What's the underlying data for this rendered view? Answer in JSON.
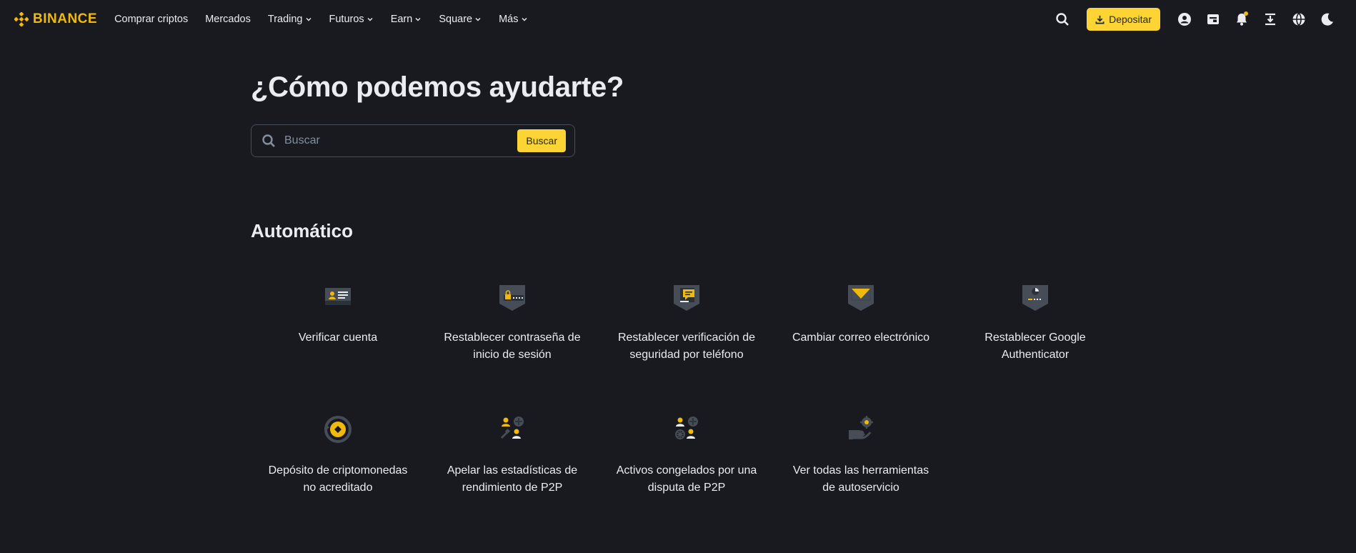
{
  "brand": {
    "name": "BINANCE",
    "color": "#f0b90b"
  },
  "nav": {
    "items": [
      {
        "label": "Comprar criptos",
        "dropdown": false
      },
      {
        "label": "Mercados",
        "dropdown": false
      },
      {
        "label": "Trading",
        "dropdown": true
      },
      {
        "label": "Futuros",
        "dropdown": true
      },
      {
        "label": "Earn",
        "dropdown": true
      },
      {
        "label": "Square",
        "dropdown": true
      },
      {
        "label": "Más",
        "dropdown": true
      }
    ],
    "deposit_label": "Depositar",
    "right_icons": [
      "search-icon",
      "user-icon",
      "wallet-icon",
      "bell-icon",
      "download-icon",
      "globe-icon",
      "moon-icon"
    ]
  },
  "hero": {
    "title": "¿Cómo podemos ayudarte?",
    "search_placeholder": "Buscar",
    "search_button": "Buscar"
  },
  "section": {
    "title": "Automático",
    "cards": [
      {
        "label": "Verificar cuenta",
        "icon": "id-card-icon"
      },
      {
        "label": "Restablecer contraseña de inicio de sesión",
        "icon": "lock-password-icon"
      },
      {
        "label": "Restablecer verificación de seguridad por teléfono",
        "icon": "phone-message-icon"
      },
      {
        "label": "Cambiar correo electrónico",
        "icon": "envelope-icon"
      },
      {
        "label": "Restablecer Google Authenticator",
        "icon": "authenticator-icon"
      },
      {
        "label": "Depósito de criptomonedas no acreditado",
        "icon": "crypto-deposit-icon"
      },
      {
        "label": "Apelar las estadísticas de rendimiento de P2P",
        "icon": "p2p-appeal-icon"
      },
      {
        "label": "Activos congelados por una disputa de P2P",
        "icon": "frozen-assets-icon"
      },
      {
        "label": "Ver todas las herramientas de autoservicio",
        "icon": "self-service-icon"
      }
    ]
  },
  "colors": {
    "background": "#181a20",
    "accent": "#fcd535",
    "text": "#eaecef",
    "muted": "#848e9c",
    "icon_gray": "#474d57"
  }
}
